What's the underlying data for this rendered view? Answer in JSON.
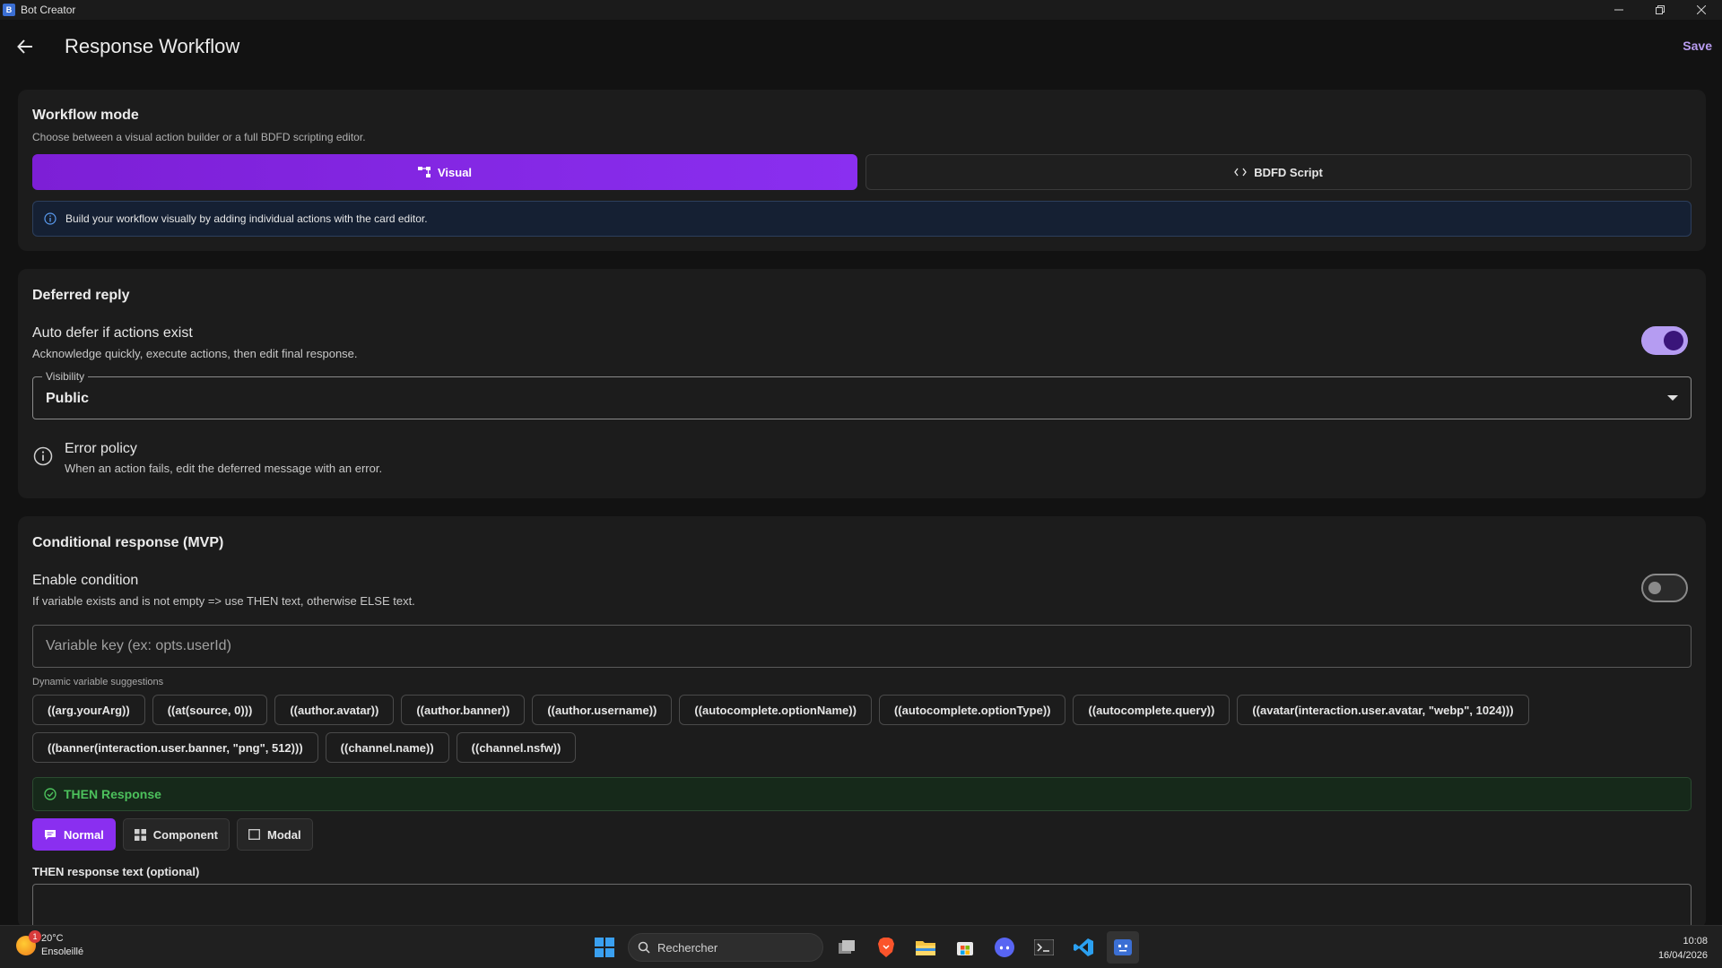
{
  "window": {
    "title": "Bot Creator",
    "controls": [
      "minimize-icon",
      "restore-icon",
      "close-icon"
    ]
  },
  "appbar": {
    "title": "Response Workflow",
    "save_label": "Save"
  },
  "workflow_mode": {
    "title": "Workflow mode",
    "description": "Choose between a visual action builder or a full BDFD scripting editor.",
    "options": [
      {
        "label": "Visual",
        "icon": "flowchart-icon",
        "selected": true
      },
      {
        "label": "BDFD Script",
        "icon": "code-icon",
        "selected": false
      }
    ],
    "info": "Build your workflow visually by adding individual actions with the card editor."
  },
  "deferred_reply": {
    "title": "Deferred reply",
    "auto_defer_label": "Auto defer if actions exist",
    "auto_defer_sub": "Acknowledge quickly, execute actions, then edit final response.",
    "auto_defer_on": true,
    "visibility_label": "Visibility",
    "visibility_value": "Public",
    "error_policy_label": "Error policy",
    "error_policy_sub": "When an action fails, edit the deferred message with an error."
  },
  "conditional": {
    "title": "Conditional response (MVP)",
    "enable_label": "Enable condition",
    "enable_sub": "If variable exists and is not empty => use THEN text, otherwise ELSE text.",
    "enable_on": false,
    "variable_placeholder": "Variable key (ex: opts.userId)",
    "suggestions_label": "Dynamic variable suggestions",
    "suggestions_row1": [
      "((arg.yourArg))",
      "((at(source, 0)))",
      "((author.avatar))",
      "((author.banner))",
      "((author.username))",
      "((autocomplete.optionName))",
      "((autocomplete.optionType))",
      "((autocomplete.query))",
      "((avatar(interaction.user.avatar, \"webp\", 1024)))"
    ],
    "suggestions_row2": [
      "((banner(interaction.user.banner, \"png\", 512)))",
      "((channel.name))",
      "((channel.nsfw))"
    ],
    "then_label": "THEN Response",
    "modes": [
      {
        "label": "Normal",
        "icon": "message-icon",
        "active": true
      },
      {
        "label": "Component",
        "icon": "grid-icon",
        "active": false
      },
      {
        "label": "Modal",
        "icon": "window-icon",
        "active": false
      }
    ],
    "then_text_label": "THEN response text (optional)"
  },
  "taskbar": {
    "weather_temp": "20°C",
    "weather_desc": "Ensoleillé",
    "weather_badge": "1",
    "search_placeholder": "Rechercher",
    "time": "10:08",
    "date": "16/04/2026"
  },
  "colors": {
    "accent": "#8a2ff0",
    "success": "#4cc15c",
    "info_bg": "#152033",
    "background": "#121212",
    "card": "#1c1c1c"
  }
}
